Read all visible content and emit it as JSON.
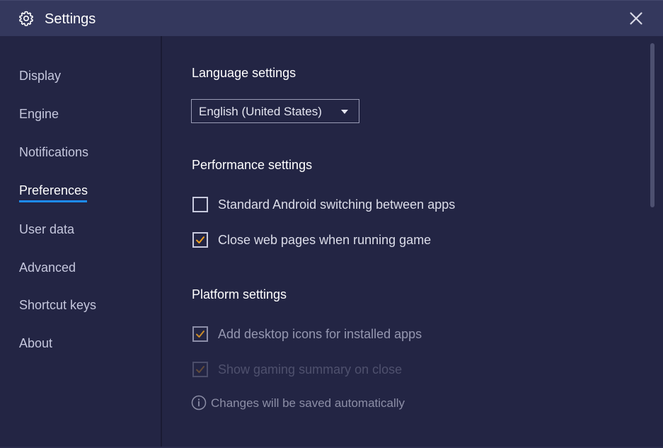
{
  "window": {
    "title": "Settings",
    "title_icon": "gear-icon",
    "close_icon": "close-icon"
  },
  "sidebar": {
    "items": [
      {
        "label": "Display",
        "active": false
      },
      {
        "label": "Engine",
        "active": false
      },
      {
        "label": "Notifications",
        "active": false
      },
      {
        "label": "Preferences",
        "active": true
      },
      {
        "label": "User data",
        "active": false
      },
      {
        "label": "Advanced",
        "active": false
      },
      {
        "label": "Shortcut keys",
        "active": false
      },
      {
        "label": "About",
        "active": false
      }
    ]
  },
  "content": {
    "language": {
      "title": "Language settings",
      "selected": "English (United States)"
    },
    "performance": {
      "title": "Performance settings",
      "options": [
        {
          "label": "Standard Android switching between apps",
          "checked": false
        },
        {
          "label": "Close web pages when running game",
          "checked": true
        }
      ]
    },
    "platform": {
      "title": "Platform settings",
      "options": [
        {
          "label": "Add desktop icons for installed apps",
          "checked": true
        },
        {
          "label": "Show gaming summary on close",
          "checked": true
        }
      ]
    },
    "info": {
      "icon": "info-icon",
      "text": "Changes will be saved automatically"
    }
  },
  "colors": {
    "background": "#232544",
    "titlebar": "#34385d",
    "accent": "#1d8bf5",
    "checkmark": "#f0a020"
  }
}
